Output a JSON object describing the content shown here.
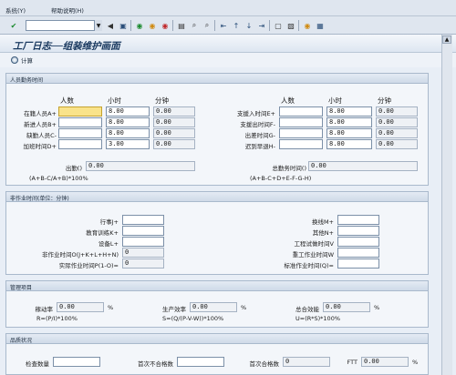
{
  "menubar": {
    "items": [
      "系统(Y)",
      "帮助说明(H)"
    ]
  },
  "toolbar": {
    "icons": [
      "check-icon",
      "save-icon",
      "back-icon",
      "exit-icon",
      "cancel-icon",
      "print-icon",
      "find-icon",
      "find-next-icon",
      "first-page-icon",
      "prev-page-icon",
      "next-page-icon",
      "last-page-icon",
      "new-session-icon",
      "shortcut-icon",
      "help-icon",
      "layout-icon"
    ]
  },
  "title": "工厂日志──组装维护画面",
  "calc_label": "计算",
  "personnel": {
    "section_title": "人员勤务时间",
    "col_headers": [
      "人数",
      "小时",
      "分钟"
    ],
    "left_rows": [
      {
        "label": "在籍人员A+",
        "count": "",
        "hours": "8.00",
        "minutes": "0.00"
      },
      {
        "label": "新进人员B+",
        "count": "",
        "hours": "8.00",
        "minutes": "0.00"
      },
      {
        "label": "缺勤人员C-",
        "count": "",
        "hours": "8.00",
        "minutes": "0.00"
      },
      {
        "label": "加班时间D+",
        "count": "",
        "hours": "3.00",
        "minutes": "0.00"
      }
    ],
    "right_rows": [
      {
        "label": "支援入时间E+",
        "count": "",
        "hours": "8.00",
        "minutes": "0.00"
      },
      {
        "label": "支援出时间F-",
        "count": "",
        "hours": "8.00",
        "minutes": "0.00"
      },
      {
        "label": "出差时间G-",
        "count": "",
        "hours": "8.00",
        "minutes": "0.00"
      },
      {
        "label": "迟到早退H-",
        "count": "",
        "hours": "8.00",
        "minutes": "0.00"
      }
    ],
    "attendance_label": "出勤()",
    "attendance_value": "0.00",
    "attendance_formula": "(A+B-C/A+B)*100%",
    "total_label": "总勤务时间()",
    "total_value": "0.00",
    "total_formula": "(A+B-C+D+E-F-G-H)"
  },
  "nonwork": {
    "section_title": "非作业时间(单位：分钟)",
    "left_rows": [
      {
        "label": "行事J+",
        "value": ""
      },
      {
        "label": "教育训练K+",
        "value": ""
      },
      {
        "label": "设备L+",
        "value": ""
      },
      {
        "label": "非作业时间O(J+K+L+H+N)",
        "value": "0"
      },
      {
        "label": "实际作业时间P(1-O)=",
        "value": "0"
      }
    ],
    "right_rows": [
      {
        "label": "换线M+",
        "value": ""
      },
      {
        "label": "其他N+",
        "value": ""
      },
      {
        "label": "工程试做时间V",
        "value": ""
      },
      {
        "label": "重工作业时间W",
        "value": ""
      },
      {
        "label": "标准作业时间(Q)=",
        "value": ""
      }
    ]
  },
  "management": {
    "section_title": "管理项目",
    "items": [
      {
        "label": "稼动率",
        "value": "0.00",
        "unit": "%",
        "formula": "R=(P/I)*100%"
      },
      {
        "label": "生产效率",
        "value": "0.00",
        "unit": "%",
        "formula": "S=(Q/(P-V-W))*100%"
      },
      {
        "label": "总合效能",
        "value": "0.00",
        "unit": "%",
        "formula": "U=(R*S)*100%"
      }
    ]
  },
  "quality": {
    "section_title": "品质状况",
    "items": [
      {
        "label": "检查数量",
        "value": ""
      },
      {
        "label": "首次不合格数",
        "value": ""
      },
      {
        "label": "首次合格数",
        "value": "0"
      },
      {
        "label": "FTT",
        "value": "0.00",
        "unit": "%"
      }
    ]
  }
}
